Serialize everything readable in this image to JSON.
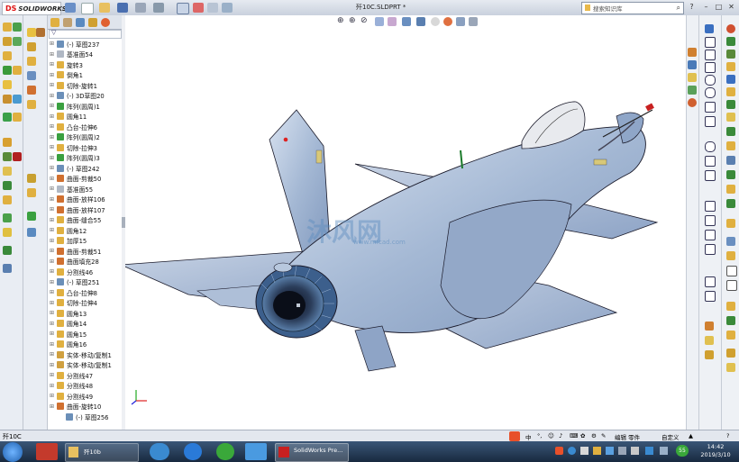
{
  "titlebar": {
    "logo_ds": "DS",
    "logo_name": "SOLIDWORKS",
    "document": "歼10C.SLDPRT *",
    "search_placeholder": "搜索知识库"
  },
  "feature_tree": {
    "items": [
      {
        "label": "(-) 草图237",
        "icon": "sketch-icon",
        "color": "#6b8fb8"
      },
      {
        "label": "基准面54",
        "icon": "plane-icon",
        "color": "#b0b8c4"
      },
      {
        "label": "旋转3",
        "icon": "revolve-icon",
        "color": "#e0b040"
      },
      {
        "label": "倒角1",
        "icon": "chamfer-icon",
        "color": "#e0b040"
      },
      {
        "label": "切除-旋转1",
        "icon": "cut-revolve-icon",
        "color": "#e0b040"
      },
      {
        "label": "(-) 3D草图20",
        "icon": "sketch3d-icon",
        "color": "#6b8fb8"
      },
      {
        "label": "阵列(圆周)1",
        "icon": "circular-pattern-icon",
        "color": "#3aa040"
      },
      {
        "label": "圆角11",
        "icon": "fillet-icon",
        "color": "#e0b040"
      },
      {
        "label": "凸台-拉伸6",
        "icon": "boss-extrude-icon",
        "color": "#e0b040"
      },
      {
        "label": "阵列(圆周)2",
        "icon": "circular-pattern-icon",
        "color": "#3aa040"
      },
      {
        "label": "切除-拉伸3",
        "icon": "cut-extrude-icon",
        "color": "#e0b040"
      },
      {
        "label": "阵列(圆周)3",
        "icon": "circular-pattern-icon",
        "color": "#3aa040"
      },
      {
        "label": "(-) 草图242",
        "icon": "sketch-icon",
        "color": "#6b8fb8"
      },
      {
        "label": "曲面-剪裁50",
        "icon": "surface-trim-icon",
        "color": "#d07030"
      },
      {
        "label": "基准面55",
        "icon": "plane-icon",
        "color": "#b0b8c4"
      },
      {
        "label": "曲面-放样106",
        "icon": "surface-loft-icon",
        "color": "#d07030"
      },
      {
        "label": "曲面-放样107",
        "icon": "surface-loft-icon",
        "color": "#d07030"
      },
      {
        "label": "曲面-缝合55",
        "icon": "surface-knit-icon",
        "color": "#e0b040"
      },
      {
        "label": "圆角12",
        "icon": "fillet-icon",
        "color": "#e0b040"
      },
      {
        "label": "加厚15",
        "icon": "thicken-icon",
        "color": "#e0b040"
      },
      {
        "label": "曲面-剪裁51",
        "icon": "surface-trim-icon",
        "color": "#d07030"
      },
      {
        "label": "曲面填充28",
        "icon": "surface-fill-icon",
        "color": "#d07030"
      },
      {
        "label": "分割线46",
        "icon": "split-line-icon",
        "color": "#e0b040"
      },
      {
        "label": "(-) 草图251",
        "icon": "sketch-icon",
        "color": "#6b8fb8"
      },
      {
        "label": "凸台-拉伸8",
        "icon": "boss-extrude-icon",
        "color": "#e0b040"
      },
      {
        "label": "切除-拉伸4",
        "icon": "cut-extrude-icon",
        "color": "#e0b040"
      },
      {
        "label": "圆角13",
        "icon": "fillet-icon",
        "color": "#e0b040"
      },
      {
        "label": "圆角14",
        "icon": "fillet-icon",
        "color": "#e0b040"
      },
      {
        "label": "圆角15",
        "icon": "fillet-icon",
        "color": "#e0b040"
      },
      {
        "label": "圆角16",
        "icon": "fillet-icon",
        "color": "#e0b040"
      },
      {
        "label": "实体-移动/复制1",
        "icon": "move-body-icon",
        "color": "#d0a040"
      },
      {
        "label": "实体-移动/复制1",
        "icon": "move-body-icon",
        "color": "#d0a040"
      },
      {
        "label": "分割线47",
        "icon": "split-line-icon",
        "color": "#e0b040"
      },
      {
        "label": "分割线48",
        "icon": "split-line-icon",
        "color": "#e0b040"
      },
      {
        "label": "分割线49",
        "icon": "split-line-icon",
        "color": "#e0b040"
      },
      {
        "label": "曲面-旋转10",
        "icon": "surface-revolve-icon",
        "color": "#d07030"
      },
      {
        "label": "(-) 草图256",
        "icon": "sketch-icon",
        "color": "#6b8fb8"
      }
    ]
  },
  "watermark": {
    "text": "沐风网",
    "url": "www.mfcad.com"
  },
  "status": {
    "left": "歼10C",
    "mode": "编辑 零件",
    "custom": "自定义"
  },
  "taskbar": {
    "task1": "歼10b",
    "task2": "SolidWorks Pre...",
    "time": "14:42",
    "date": "2019/3/10",
    "ime_badge": "55"
  },
  "colors": {
    "aircraft_body": "#a4b8d4",
    "aircraft_edge": "#1a1a2a",
    "canopy": "#e8eaee",
    "nozzle": "#3c5f8c"
  }
}
